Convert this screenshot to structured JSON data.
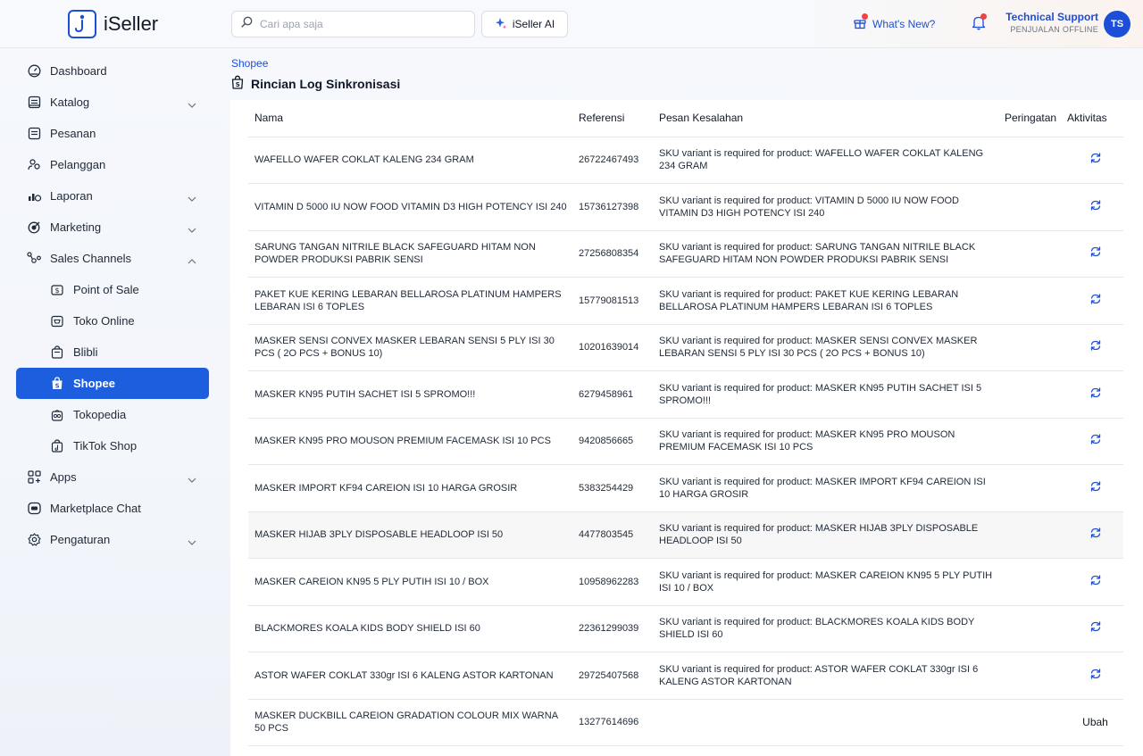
{
  "app": {
    "brand": "iSeller"
  },
  "header": {
    "search_placeholder": "Cari apa saja",
    "ai_button": "iSeller AI",
    "whats_new": "What's New?",
    "user_name": "Technical Support",
    "user_role": "PENJUALAN OFFLINE",
    "user_initials": "TS"
  },
  "sidebar": {
    "items": [
      {
        "label": "Dashboard"
      },
      {
        "label": "Katalog"
      },
      {
        "label": "Pesanan"
      },
      {
        "label": "Pelanggan"
      },
      {
        "label": "Laporan"
      },
      {
        "label": "Marketing"
      },
      {
        "label": "Sales Channels"
      },
      {
        "label": "Point of Sale"
      },
      {
        "label": "Toko Online"
      },
      {
        "label": "Blibli"
      },
      {
        "label": "Shopee"
      },
      {
        "label": "Tokopedia"
      },
      {
        "label": "TikTok Shop"
      },
      {
        "label": "Apps"
      },
      {
        "label": "Marketplace Chat"
      },
      {
        "label": "Pengaturan"
      }
    ]
  },
  "page": {
    "breadcrumb": "Shopee",
    "title": "Rincian Log Sinkronisasi"
  },
  "table": {
    "headers": {
      "nama": "Nama",
      "referensi": "Referensi",
      "pesan": "Pesan Kesalahan",
      "peringatan": "Peringatan",
      "aktivitas": "Aktivitas"
    },
    "rows": [
      {
        "nama": "WAFELLO WAFER COKLAT KALENG 234 GRAM",
        "ref": "26722467493",
        "pesan": "SKU variant is required for product: WAFELLO WAFER COKLAT KALENG 234 GRAM",
        "aktivitas": ""
      },
      {
        "nama": "VITAMIN D 5000 IU NOW FOOD VITAMIN D3 HIGH POTENCY ISI 240",
        "ref": "15736127398",
        "pesan": "SKU variant is required for product: VITAMIN D 5000 IU NOW FOOD VITAMIN D3 HIGH POTENCY ISI 240",
        "aktivitas": ""
      },
      {
        "nama": "SARUNG TANGAN NITRILE BLACK SAFEGUARD HITAM NON POWDER PRODUKSI PABRIK SENSI",
        "ref": "27256808354",
        "pesan": "SKU variant is required for product: SARUNG TANGAN NITRILE BLACK SAFEGUARD HITAM NON POWDER PRODUKSI PABRIK SENSI",
        "aktivitas": ""
      },
      {
        "nama": "PAKET KUE KERING LEBARAN BELLAROSA PLATINUM HAMPERS LEBARAN ISI 6 TOPLES",
        "ref": "15779081513",
        "pesan": "SKU variant is required for product: PAKET KUE KERING LEBARAN BELLAROSA PLATINUM HAMPERS LEBARAN ISI 6 TOPLES",
        "aktivitas": ""
      },
      {
        "nama": "MASKER SENSI CONVEX MASKER LEBARAN SENSI 5 PLY ISI 30 PCS ( 2O PCS + BONUS 10)",
        "ref": "10201639014",
        "pesan": "SKU variant is required for product: MASKER SENSI CONVEX MASKER LEBARAN SENSI 5 PLY ISI 30 PCS ( 2O PCS + BONUS 10)",
        "aktivitas": ""
      },
      {
        "nama": "MASKER KN95 PUTIH SACHET ISI 5 SPROMO!!!",
        "ref": "6279458961",
        "pesan": "SKU variant is required for product: MASKER KN95 PUTIH SACHET ISI 5 SPROMO!!!",
        "aktivitas": ""
      },
      {
        "nama": "MASKER KN95 PRO MOUSON PREMIUM FACEMASK ISI 10 PCS",
        "ref": "9420856665",
        "pesan": "SKU variant is required for product: MASKER KN95 PRO MOUSON PREMIUM FACEMASK ISI 10 PCS",
        "aktivitas": ""
      },
      {
        "nama": "MASKER IMPORT KF94 CAREION ISI 10 HARGA GROSIR",
        "ref": "5383254429",
        "pesan": "SKU variant is required for product: MASKER IMPORT KF94 CAREION ISI 10 HARGA GROSIR",
        "aktivitas": ""
      },
      {
        "nama": "MASKER HIJAB 3PLY DISPOSABLE HEADLOOP ISI 50",
        "ref": "4477803545",
        "pesan": "SKU variant is required for product: MASKER HIJAB 3PLY DISPOSABLE HEADLOOP ISI 50",
        "aktivitas": ""
      },
      {
        "nama": "MASKER CAREION KN95 5 PLY PUTIH ISI 10 / BOX",
        "ref": "10958962283",
        "pesan": "SKU variant is required for product: MASKER CAREION KN95 5 PLY PUTIH ISI 10 / BOX",
        "aktivitas": ""
      },
      {
        "nama": "BLACKMORES KOALA KIDS BODY SHIELD ISI 60",
        "ref": "22361299039",
        "pesan": "SKU variant is required for product: BLACKMORES KOALA KIDS BODY SHIELD ISI 60",
        "aktivitas": ""
      },
      {
        "nama": "ASTOR WAFER COKLAT 330gr ISI 6 KALENG ASTOR KARTONAN",
        "ref": "29725407568",
        "pesan": "SKU variant is required for product: ASTOR WAFER COKLAT 330gr ISI 6 KALENG ASTOR KARTONAN",
        "aktivitas": ""
      },
      {
        "nama": "MASKER DUCKBILL CAREION GRADATION COLOUR MIX WARNA 50 PCS",
        "ref": "13277614696",
        "pesan": "",
        "aktivitas": "Ubah"
      }
    ]
  },
  "colors": {
    "primary": "#1d5ede",
    "link": "#1d4ed8",
    "notification": "#ef4444"
  }
}
